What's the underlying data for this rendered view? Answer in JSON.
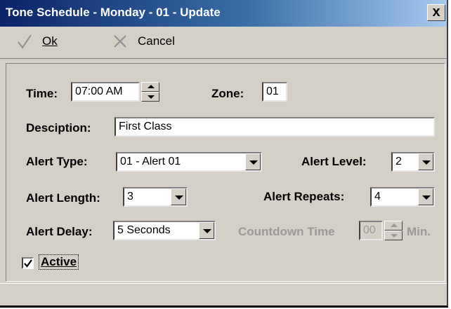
{
  "window": {
    "title": "Tone Schedule - Monday - 01 - Update",
    "close_glyph": "x"
  },
  "toolbar": {
    "ok_label": "Ok",
    "cancel_label": "Cancel",
    "ok_icon": "checkmark-icon",
    "cancel_icon": "x-icon"
  },
  "form": {
    "time_label": "Time:",
    "time_value": "07:00 AM",
    "zone_label": "Zone:",
    "zone_value": "01",
    "description_label": "Desciption:",
    "description_value": "First Class",
    "alert_type_label": "Alert Type:",
    "alert_type_value": "01 - Alert 01",
    "alert_level_label": "Alert Level:",
    "alert_level_value": "2",
    "alert_length_label": "Alert Length:",
    "alert_length_value": "3",
    "alert_repeats_label": "Alert Repeats:",
    "alert_repeats_value": "4",
    "alert_delay_label": "Alert Delay:",
    "alert_delay_value": "5 Seconds",
    "countdown_label": "Countdown Time",
    "countdown_value": "00",
    "countdown_unit": "Min.",
    "active_label": "Active",
    "active_checked": true
  },
  "colors": {
    "titlebar_start": "#0a246a",
    "titlebar_end": "#a6caf0",
    "face": "#d4d0c8"
  }
}
